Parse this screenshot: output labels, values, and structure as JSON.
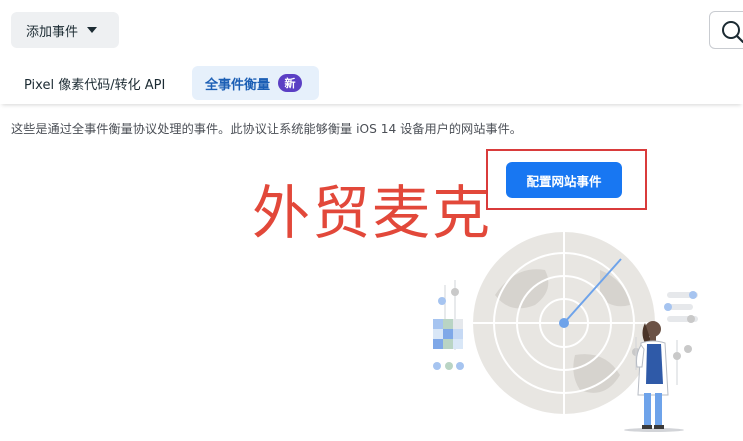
{
  "toolbar": {
    "add_event_label": "添加事件",
    "search_icon": "search-icon"
  },
  "tabs": [
    {
      "label": "Pixel 像素代码/转化 API",
      "active": false
    },
    {
      "label": "全事件衡量",
      "active": true,
      "badge": "新"
    }
  ],
  "description": "这些是通过全事件衡量协议处理的事件。此协议让系统能够衡量 iOS 14 设备用户的网站事件。",
  "configure_button_label": "配置网站事件",
  "watermark_text": "外贸麦克",
  "colors": {
    "accent_blue": "#1877f2",
    "active_tab_bg": "#e6f0fb",
    "badge_purple": "#5b3fc4",
    "highlight_red": "#d93b3b",
    "watermark_red": "#e2483a"
  },
  "illustration": {
    "icon": "radar-scientist-illustration"
  }
}
